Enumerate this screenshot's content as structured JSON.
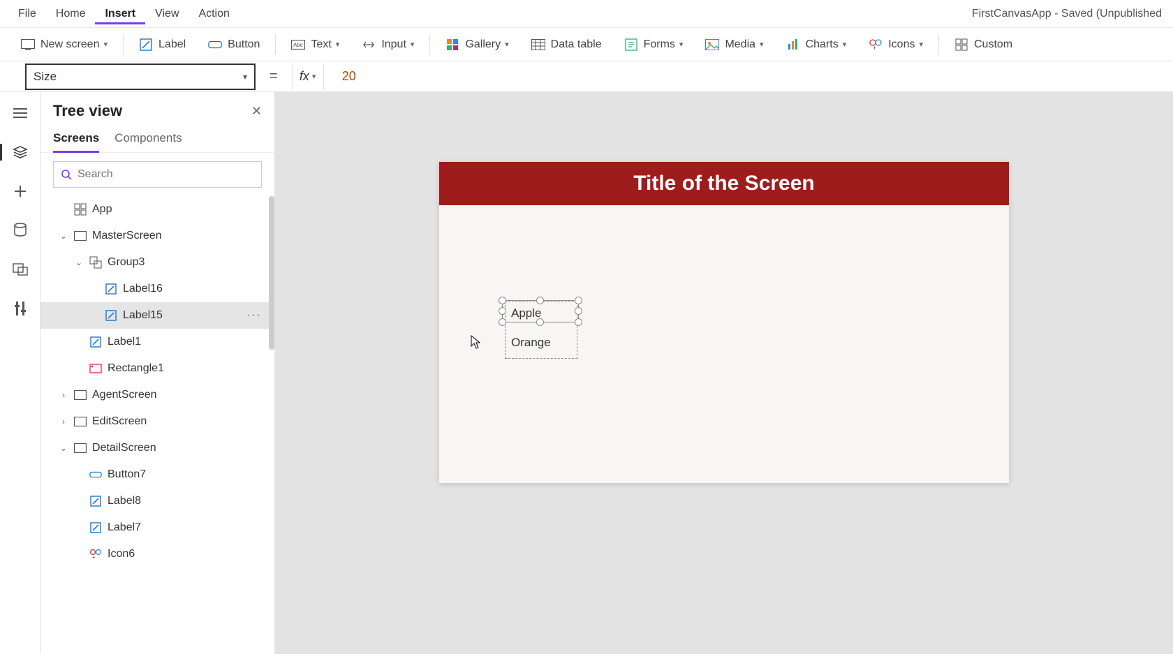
{
  "menubar": {
    "items": [
      "File",
      "Home",
      "Insert",
      "View",
      "Action"
    ],
    "active_index": 2,
    "app_title": "FirstCanvasApp - Saved (Unpublished"
  },
  "ribbon": {
    "new_screen": "New screen",
    "label": "Label",
    "button": "Button",
    "text": "Text",
    "input": "Input",
    "gallery": "Gallery",
    "data_table": "Data table",
    "forms": "Forms",
    "media": "Media",
    "charts": "Charts",
    "icons": "Icons",
    "custom": "Custom"
  },
  "formula": {
    "property": "Size",
    "value": "20"
  },
  "tree": {
    "title": "Tree view",
    "tabs": [
      "Screens",
      "Components"
    ],
    "active_tab": 0,
    "search_placeholder": "Search",
    "nodes": [
      {
        "label": "App",
        "depth": 0,
        "icon": "app",
        "expander": ""
      },
      {
        "label": "MasterScreen",
        "depth": 0,
        "icon": "screen",
        "expander": "down"
      },
      {
        "label": "Group3",
        "depth": 1,
        "icon": "group",
        "expander": "down"
      },
      {
        "label": "Label16",
        "depth": 2,
        "icon": "label",
        "expander": ""
      },
      {
        "label": "Label15",
        "depth": 2,
        "icon": "label",
        "expander": "",
        "selected": true,
        "more": true
      },
      {
        "label": "Label1",
        "depth": 1,
        "icon": "label",
        "expander": ""
      },
      {
        "label": "Rectangle1",
        "depth": 1,
        "icon": "rect",
        "expander": ""
      },
      {
        "label": "AgentScreen",
        "depth": 0,
        "icon": "screen",
        "expander": "right"
      },
      {
        "label": "EditScreen",
        "depth": 0,
        "icon": "screen",
        "expander": "right"
      },
      {
        "label": "DetailScreen",
        "depth": 0,
        "icon": "screen",
        "expander": "down"
      },
      {
        "label": "Button7",
        "depth": 1,
        "icon": "button",
        "expander": ""
      },
      {
        "label": "Label8",
        "depth": 1,
        "icon": "label",
        "expander": ""
      },
      {
        "label": "Label7",
        "depth": 1,
        "icon": "label",
        "expander": ""
      },
      {
        "label": "Icon6",
        "depth": 1,
        "icon": "iconctl",
        "expander": ""
      }
    ]
  },
  "canvas": {
    "screen_title": "Title of the Screen",
    "label_a": "Apple",
    "label_b": "Orange"
  },
  "colors": {
    "accent_purple": "#7c3aed",
    "title_bar_red": "#9e1c1c",
    "formula_value": "#b54708"
  }
}
